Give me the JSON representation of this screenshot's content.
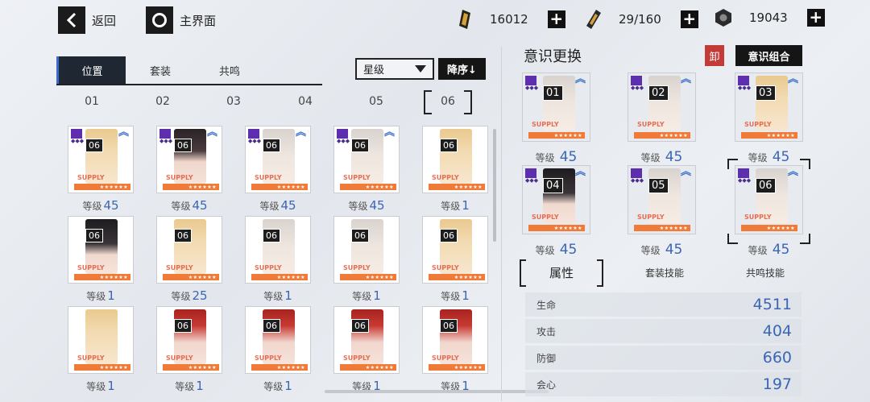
{
  "topbar": {
    "back_label": "返回",
    "home_label": "主界面",
    "resources": [
      {
        "icon": "gold-bar-icon",
        "value": "16012"
      },
      {
        "icon": "battery-icon",
        "value": "29/160"
      },
      {
        "icon": "hex-nut-icon",
        "value": "19043"
      }
    ]
  },
  "left": {
    "tabs": [
      "位置",
      "套装",
      "共鸣"
    ],
    "sort_select": "星级",
    "sort_button": "降序↓",
    "columns": [
      "01",
      "02",
      "03",
      "04",
      "05",
      "06"
    ],
    "selected_column": "06",
    "level_prefix": "等级",
    "supply_text": "SUPPLY",
    "stars": "★★★★★★",
    "cards": [
      {
        "num": "06",
        "level": "45",
        "hair": "blonde",
        "tagged": true
      },
      {
        "num": "06",
        "level": "45",
        "hair": "dark",
        "tagged": true
      },
      {
        "num": "06",
        "level": "45",
        "hair": "silver",
        "tagged": true
      },
      {
        "num": "06",
        "level": "45",
        "hair": "silver",
        "tagged": true
      },
      {
        "num": "06",
        "level": "1",
        "hair": "blonde",
        "tagged": false
      },
      {
        "num": "06",
        "level": "1",
        "hair": "black",
        "tagged": false
      },
      {
        "num": "06",
        "level": "25",
        "hair": "blonde",
        "tagged": false
      },
      {
        "num": "06",
        "level": "1",
        "hair": "silver",
        "tagged": false
      },
      {
        "num": "06",
        "level": "1",
        "hair": "silver",
        "tagged": false
      },
      {
        "num": "06",
        "level": "1",
        "hair": "blonde",
        "tagged": false
      },
      {
        "num": "",
        "level": "1",
        "hair": "blonde",
        "tagged": false
      },
      {
        "num": "06",
        "level": "1",
        "hair": "red",
        "tagged": false
      },
      {
        "num": "06",
        "level": "1",
        "hair": "red",
        "tagged": false
      },
      {
        "num": "06",
        "level": "1",
        "hair": "red",
        "tagged": false
      },
      {
        "num": "06",
        "level": "1",
        "hair": "red",
        "tagged": false
      }
    ]
  },
  "right": {
    "title": "意识更换",
    "unload": "卸",
    "combo": "意识组合",
    "slots": [
      {
        "num": "01",
        "level": "45",
        "hair": "silver"
      },
      {
        "num": "02",
        "level": "45",
        "hair": "silver"
      },
      {
        "num": "03",
        "level": "45",
        "hair": "blonde"
      },
      {
        "num": "04",
        "level": "45",
        "hair": "black"
      },
      {
        "num": "05",
        "level": "45",
        "hair": "silver"
      },
      {
        "num": "06",
        "level": "45",
        "hair": "silver"
      }
    ],
    "sub_tabs": [
      "属性",
      "套装技能",
      "共鸣技能"
    ],
    "stats": [
      {
        "name": "生命",
        "value": "4511"
      },
      {
        "name": "攻击",
        "value": "404"
      },
      {
        "name": "防御",
        "value": "660"
      },
      {
        "name": "会心",
        "value": "197"
      }
    ]
  }
}
